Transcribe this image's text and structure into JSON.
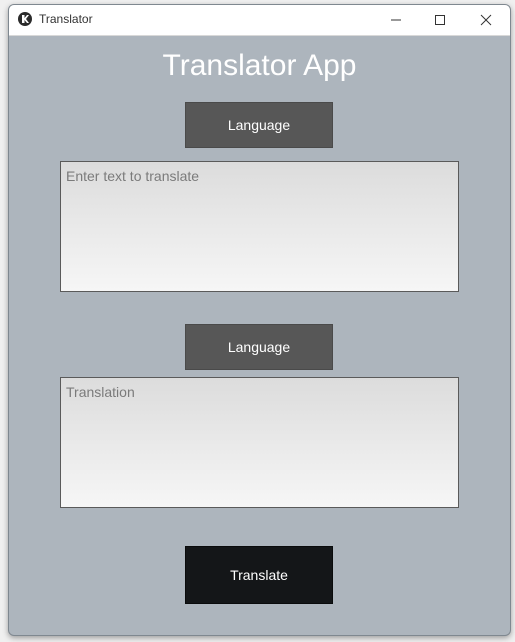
{
  "window": {
    "title": "Translator",
    "icon": "kivy-app-icon"
  },
  "titlebar_controls": [
    "minimize-icon",
    "maximize-icon",
    "close-icon"
  ],
  "app": {
    "heading": "Translator App",
    "source_language_button": "Language",
    "source_text_placeholder": "Enter text to translate",
    "source_text_value": "",
    "target_language_button": "Language",
    "translation_placeholder": "Translation",
    "translation_value": "",
    "translate_button": "Translate"
  },
  "colors": {
    "background": "#adb5bd",
    "language_button": "#575757",
    "translate_button": "#141618",
    "text": "#ffffff",
    "placeholder": "#7b7b7b"
  }
}
